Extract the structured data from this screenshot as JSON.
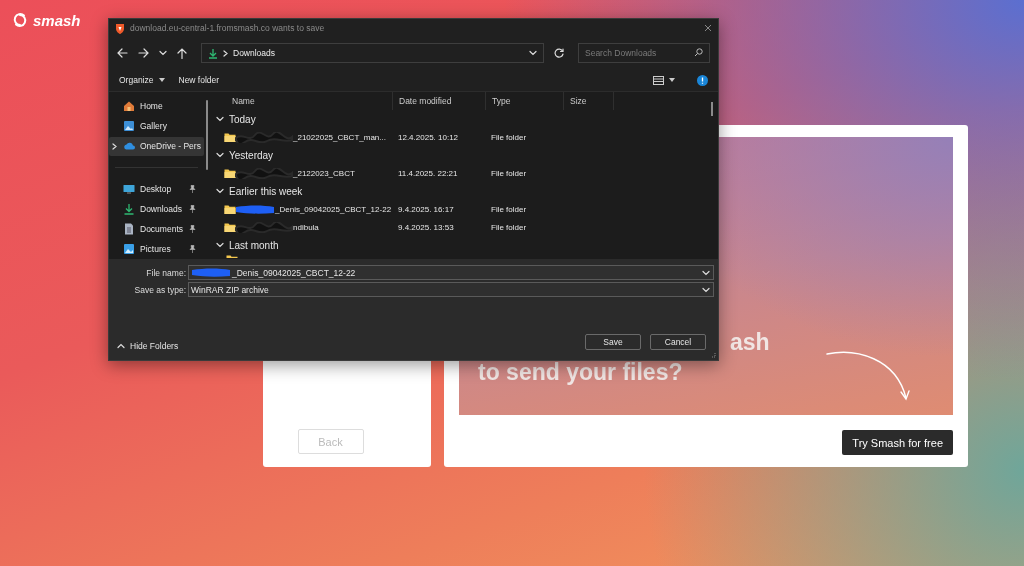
{
  "page": {
    "logo": "smash",
    "back_button": "Back",
    "headline": [
      "ash",
      "to send your files?"
    ],
    "cta_button": "Try Smash for free"
  },
  "dialog": {
    "title": "download.eu-central-1.fromsmash.co wants to save",
    "address": "Downloads",
    "search": {
      "placeholder": "Search Downloads"
    },
    "toolbar": [
      {
        "label": "Organize",
        "kind": "menu"
      },
      {
        "label": "New folder",
        "kind": "button"
      }
    ],
    "sidebar": {
      "items": [
        {
          "label": "Home",
          "kind": "home",
          "selected": false,
          "pinned": false,
          "expandable": false
        },
        {
          "label": "Gallery",
          "kind": "gallery",
          "selected": false,
          "pinned": false,
          "expandable": false
        },
        {
          "label": "OneDrive - Pers",
          "kind": "cloud",
          "selected": true,
          "pinned": false,
          "expandable": true
        },
        {
          "label": "Desktop",
          "kind": "desktop",
          "selected": false,
          "pinned": true,
          "expandable": false
        },
        {
          "label": "Downloads",
          "kind": "download",
          "selected": false,
          "pinned": true,
          "expandable": false
        },
        {
          "label": "Documents",
          "kind": "document",
          "selected": false,
          "pinned": true,
          "expandable": false
        },
        {
          "label": "Pictures",
          "kind": "pictures",
          "selected": false,
          "pinned": true,
          "expandable": false
        }
      ]
    },
    "columns": [
      "Name",
      "Date modified",
      "Type",
      "Size"
    ],
    "groups": [
      {
        "label": "Today",
        "expanded": true,
        "rows": [
          {
            "name": "_21022025_CBCT_man...",
            "kind": "scribble",
            "date": "12.4.2025. 10:12",
            "type": "File folder"
          }
        ]
      },
      {
        "label": "Yesterday",
        "expanded": true,
        "rows": [
          {
            "name": "_2122023_CBCT",
            "kind": "scribble",
            "date": "11.4.2025. 22:21",
            "type": "File folder"
          }
        ]
      },
      {
        "label": "Earlier this week",
        "expanded": true,
        "rows": [
          {
            "name": "_Denis_09042025_CBCT_12-22",
            "kind": "marker",
            "date": "9.4.2025. 16:17",
            "type": "File folder"
          },
          {
            "name": "ndibula",
            "kind": "scribble",
            "date": "9.4.2025. 13:53",
            "type": "File folder"
          }
        ]
      },
      {
        "label": "Last month",
        "expanded": true
      }
    ],
    "file_name": {
      "label": "File name:",
      "value": "_Denis_09042025_CBCT_12-22",
      "kind": "marker"
    },
    "save_type": {
      "label": "Save as type:",
      "value": "WinRAR ZIP archive"
    },
    "hide_folders": "Hide Folders",
    "buttons": [
      "Save",
      "Cancel"
    ]
  }
}
